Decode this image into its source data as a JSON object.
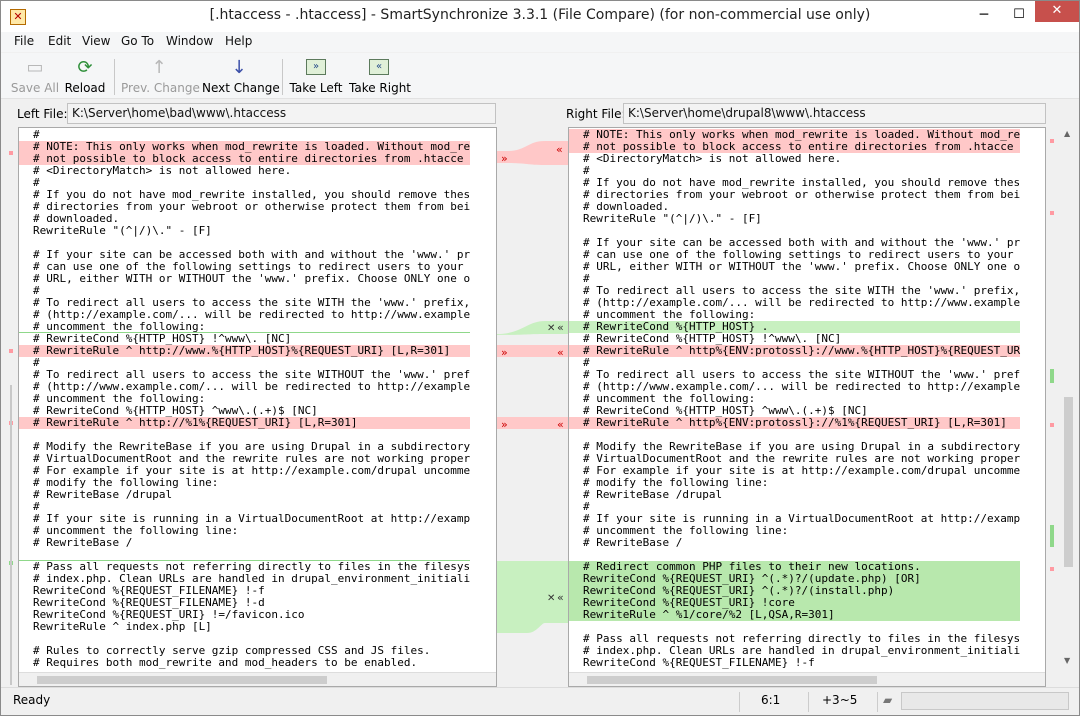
{
  "window": {
    "title": "[.htaccess - .htaccess] - SmartSynchronize 3.3.1 (File Compare) (for non-commercial use only)",
    "minimize": "─",
    "maximize": "☐",
    "close": "✕"
  },
  "menu": [
    "File",
    "Edit",
    "View",
    "Go To",
    "Window",
    "Help"
  ],
  "toolbar": {
    "save_all": "Save All",
    "reload": "Reload",
    "prev_change": "Prev. Change",
    "next_change": "Next Change",
    "take_left": "Take Left",
    "take_right": "Take Right"
  },
  "left": {
    "label": "Left File:",
    "path": "K:\\Server\\home\\bad\\www\\.htaccess",
    "lines": [
      "#",
      "# NOTE: This only works when mod_rewrite is loaded. Without mod_re",
      "# not possible to block access to entire directories from .htacce",
      "# <DirectoryMatch> is not allowed here.",
      "#",
      "# If you do not have mod_rewrite installed, you should remove thes",
      "# directories from your webroot or otherwise protect them from bei",
      "# downloaded.",
      "RewriteRule \"(^|/)\\.\" - [F]",
      "",
      "# If your site can be accessed both with and without the 'www.' pr",
      "# can use one of the following settings to redirect users to your ",
      "# URL, either WITH or WITHOUT the 'www.' prefix. Choose ONLY one o",
      "#",
      "# To redirect all users to access the site WITH the 'www.' prefix,",
      "# (http://example.com/... will be redirected to http://www.example",
      "# uncomment the following:",
      "# RewriteCond %{HTTP_HOST} !^www\\. [NC]",
      "# RewriteRule ^ http://www.%{HTTP_HOST}%{REQUEST_URI} [L,R=301]",
      "#",
      "# To redirect all users to access the site WITHOUT the 'www.' pref",
      "# (http://www.example.com/... will be redirected to http://example",
      "# uncomment the following:",
      "# RewriteCond %{HTTP_HOST} ^www\\.(.+)$ [NC]",
      "# RewriteRule ^ http://%1%{REQUEST_URI} [L,R=301]",
      "",
      "# Modify the RewriteBase if you are using Drupal in a subdirectory",
      "# VirtualDocumentRoot and the rewrite rules are not working proper",
      "# For example if your site is at http://example.com/drupal uncomme",
      "# modify the following line:",
      "# RewriteBase /drupal",
      "#",
      "# If your site is running in a VirtualDocumentRoot at http://examp",
      "# uncomment the following line:",
      "# RewriteBase /",
      "",
      "# Pass all requests not referring directly to files in the filesys",
      "# index.php. Clean URLs are handled in drupal_environment_initiali",
      "RewriteCond %{REQUEST_FILENAME} !-f",
      "RewriteCond %{REQUEST_FILENAME} !-d",
      "RewriteCond %{REQUEST_URI} !=/favicon.ico",
      "RewriteRule ^ index.php [L]",
      "",
      "# Rules to correctly serve gzip compressed CSS and JS files.",
      "# Requires both mod_rewrite and mod_headers to be enabled."
    ]
  },
  "right": {
    "label": "Right File:",
    "path": "K:\\Server\\home\\drupal8\\www\\.htaccess",
    "lines": [
      "# NOTE: This only works when mod_rewrite is loaded. Without mod_re",
      "# not possible to block access to entire directories from .htacce",
      "# <DirectoryMatch> is not allowed here.",
      "#",
      "# If you do not have mod_rewrite installed, you should remove thes",
      "# directories from your webroot or otherwise protect them from bei",
      "# downloaded.",
      "RewriteRule \"(^|/)\\.\" - [F]",
      "",
      "# If your site can be accessed both with and without the 'www.' pr",
      "# can use one of the following settings to redirect users to your",
      "# URL, either WITH or WITHOUT the 'www.' prefix. Choose ONLY one o",
      "#",
      "# To redirect all users to access the site WITH the 'www.' prefix,",
      "# (http://example.com/... will be redirected to http://www.example",
      "# uncomment the following:",
      "# RewriteCond %{HTTP_HOST} .",
      "# RewriteCond %{HTTP_HOST} !^www\\. [NC]",
      "# RewriteRule ^ http%{ENV:protossl}://www.%{HTTP_HOST}%{REQUEST_UR",
      "#",
      "# To redirect all users to access the site WITHOUT the 'www.' pref",
      "# (http://www.example.com/... will be redirected to http://example",
      "# uncomment the following:",
      "# RewriteCond %{HTTP_HOST} ^www\\.(.+)$ [NC]",
      "# RewriteRule ^ http%{ENV:protossl}://%1%{REQUEST_URI} [L,R=301]",
      "",
      "# Modify the RewriteBase if you are using Drupal in a subdirectory",
      "# VirtualDocumentRoot and the rewrite rules are not working proper",
      "# For example if your site is at http://example.com/drupal uncomme",
      "# modify the following line:",
      "# RewriteBase /drupal",
      "#",
      "# If your site is running in a VirtualDocumentRoot at http://examp",
      "# uncomment the following line:",
      "# RewriteBase /",
      "",
      "# Redirect common PHP files to their new locations.",
      "RewriteCond %{REQUEST_URI} ^(.*)?/(update.php) [OR]",
      "RewriteCond %{REQUEST_URI} ^(.*)?/(install.php)",
      "RewriteCond %{REQUEST_URI} !core",
      "RewriteRule ^ %1/core/%2 [L,QSA,R=301]",
      "",
      "# Pass all requests not referring directly to files in the filesys",
      "# index.php. Clean URLs are handled in drupal_environment_initiali",
      "RewriteCond %{REQUEST_FILENAME} !-f"
    ]
  },
  "status": {
    "ready": "Ready",
    "position": "6:1",
    "changes": "+3~5"
  }
}
